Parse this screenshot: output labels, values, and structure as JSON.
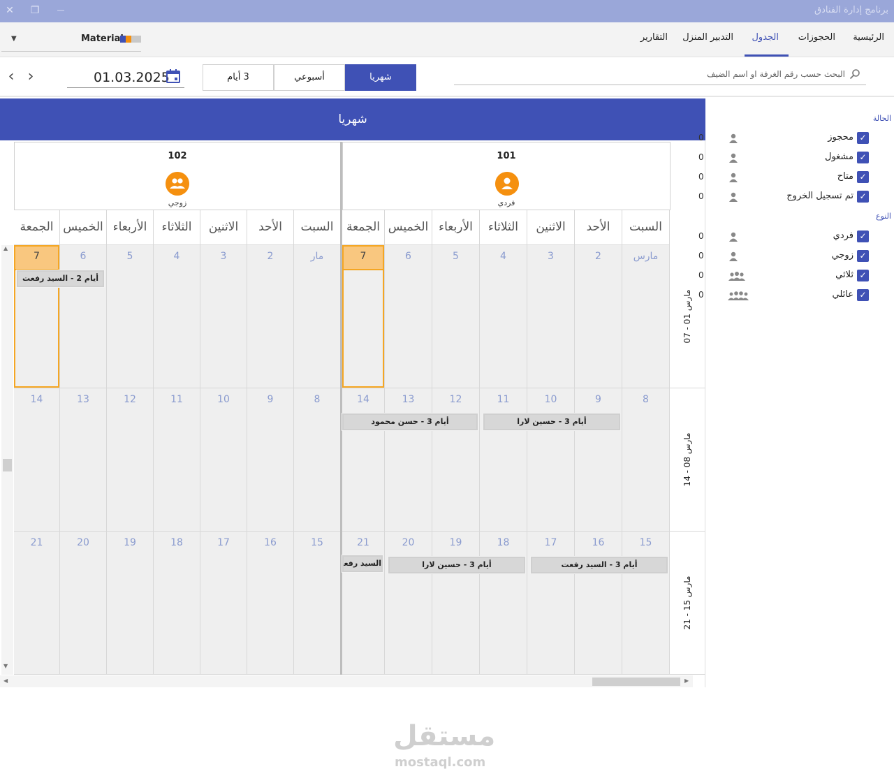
{
  "window": {
    "title": "برنامج إدارة الفنادق",
    "close": "✕",
    "restore": "❐",
    "minimize": "—"
  },
  "nav": {
    "tabs": [
      "الرئيسية",
      "الحجوزات",
      "الجدول",
      "التدبير المنزل",
      "التقارير"
    ],
    "active_tab": "الجدول",
    "theme_label": "Material",
    "theme_colors": [
      "#3f51b5",
      "#f5900f",
      "#c9c9c9"
    ]
  },
  "toolbar": {
    "date": "01.03.2025",
    "view_buttons": {
      "monthly": "شهريا",
      "weekly": "أسبوعي",
      "three_days": "3 أيام"
    },
    "active_view": "شهريا",
    "search_placeholder": "البحث حسب رقم الغرفة او اسم الضيف"
  },
  "scheduler": {
    "header": "شهريا",
    "rooms": [
      {
        "number": "101",
        "type": "فردي"
      },
      {
        "number": "102",
        "type": "زوجي"
      }
    ],
    "day_names": [
      "السبت",
      "الأحد",
      "الاثنين",
      "الثلاثاء",
      "الأربعاء",
      "الخميس",
      "الجمعة"
    ],
    "weeks": [
      {
        "label": "مارس 01 - 07",
        "days": [
          "مارس",
          "2",
          "3",
          "4",
          "5",
          "6",
          "7"
        ]
      },
      {
        "label": "مارس 08 - 14",
        "days": [
          "8",
          "9",
          "10",
          "11",
          "12",
          "13",
          "14"
        ]
      },
      {
        "label": "مارس 15 - 21",
        "days": [
          "15",
          "16",
          "17",
          "18",
          "19",
          "20",
          "21"
        ]
      }
    ],
    "room2_first_label": "مار",
    "today_day": "7",
    "appointments": {
      "r2w1": "أيام 2 - السيد رفعت",
      "r1w2a": "أيام 3 - حسين لارا",
      "r1w2b": "أيام 3 - حسن محمود",
      "r1w3a": "أيام 3 - السيد رفعت",
      "r1w3b": "أيام 3 - حسين لارا",
      "r1w3c": "السيد رفعت"
    }
  },
  "filters": {
    "status_title": "الحالة",
    "status": [
      {
        "label": "محجوز",
        "count": "0"
      },
      {
        "label": "مشغول",
        "count": "0"
      },
      {
        "label": "متاح",
        "count": "0"
      },
      {
        "label": "تم تسجيل الخروج",
        "count": "0"
      }
    ],
    "type_title": "النوع",
    "types": [
      {
        "label": "فردي",
        "count": "0",
        "icon": "single-person-icon"
      },
      {
        "label": "زوجي",
        "count": "0",
        "icon": "single-person-icon"
      },
      {
        "label": "ثلاثي",
        "count": "0",
        "icon": "three-people-icon"
      },
      {
        "label": "عائلي",
        "count": "0",
        "icon": "family-icon"
      }
    ]
  },
  "watermark": {
    "arabic": "مستقل",
    "latin": "mostaql.com"
  }
}
